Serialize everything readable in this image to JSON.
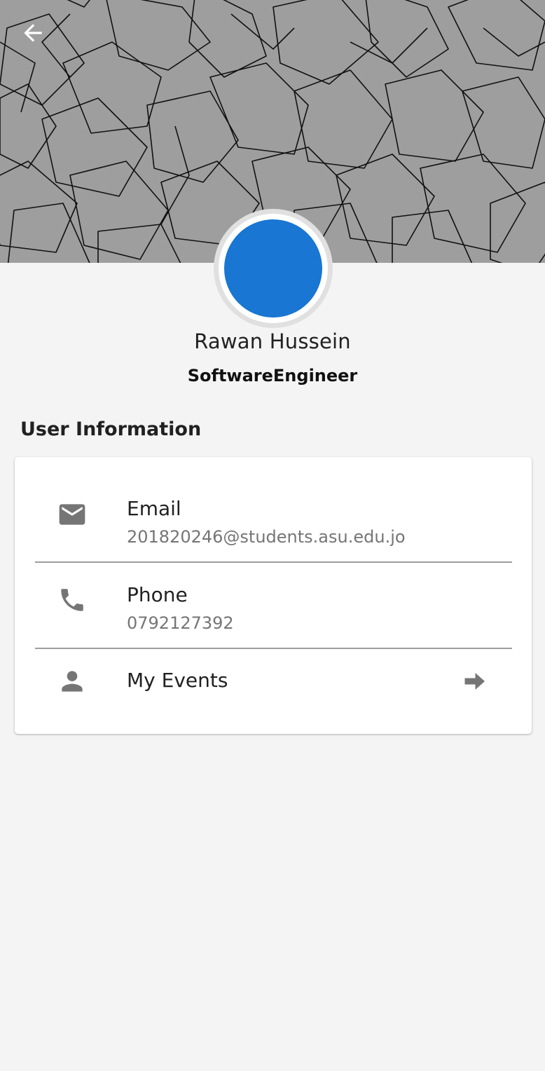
{
  "header": {
    "back_icon": "arrow-back-icon",
    "background_color": "#9e9e9e"
  },
  "profile": {
    "name": "Rawan Hussein",
    "title": "SoftwareEngineer",
    "avatar_color": "#1976d2"
  },
  "section": {
    "title": "User Information"
  },
  "info": {
    "email": {
      "icon": "email-icon",
      "label": "Email",
      "value": "201820246@students.asu.edu.jo"
    },
    "phone": {
      "icon": "phone-icon",
      "label": "Phone",
      "value": "0792127392"
    },
    "events": {
      "icon": "person-icon",
      "label": "My Events",
      "trailing_icon": "arrow-forward-icon"
    }
  },
  "colors": {
    "page_background": "#f4f4f4",
    "icon_gray": "#757575",
    "accent_blue": "#1976d2"
  }
}
